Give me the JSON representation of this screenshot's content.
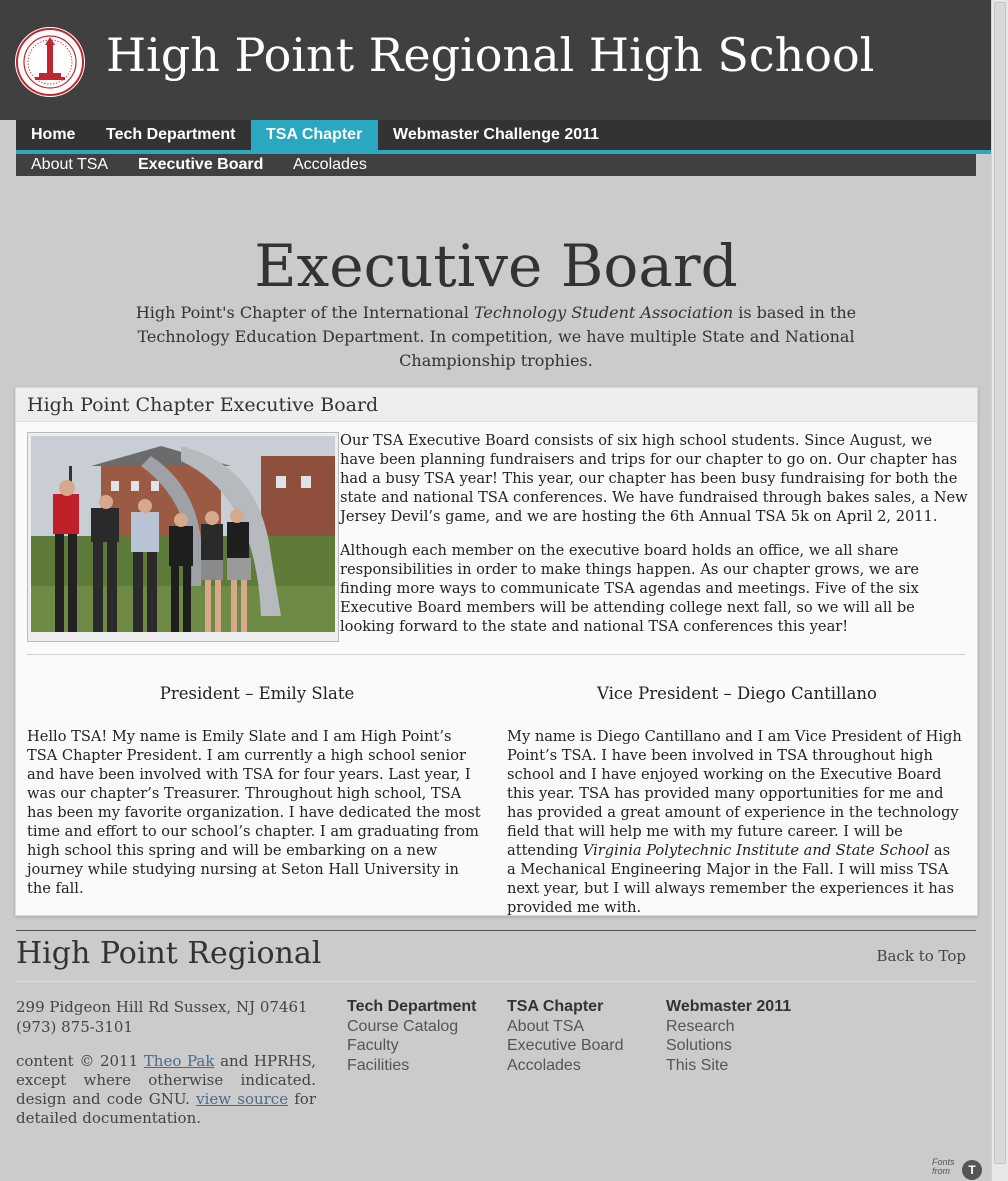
{
  "site": {
    "title": "High Point Regional High School"
  },
  "nav": {
    "main": [
      "Home",
      "Tech Department",
      "TSA Chapter",
      "Webmaster Challenge 2011"
    ],
    "active_main": "TSA Chapter",
    "sub": [
      "About TSA",
      "Executive Board",
      "Accolades"
    ],
    "active_sub": "Executive Board"
  },
  "page": {
    "title": "Executive Board",
    "intro_pre": "High Point's Chapter of the International ",
    "intro_em": "Technology Student Association",
    "intro_post": " is based in the Technology Education Department. In competition, we have multiple State and National Championship trophies."
  },
  "panel": {
    "heading": "High Point Chapter Executive Board",
    "para1": "Our TSA Executive Board consists of six high school students. Since August, we have been planning fundraisers and trips for our chapter to go on. Our chapter has had a busy TSA year! This year, our chapter has been busy fundraising for both the state and national TSA conferences. We have fundraised through bakes sales, a New Jersey Devil’s game, and we are hosting the 6th Annual TSA 5k on April 2, 2011.",
    "para2": "Although each member on the executive board holds an office, we all share responsibilities in order to make things happen. As our chapter grows, we are finding more ways to communicate TSA agendas and meetings. Five of the six Executive Board members will be attending college next fall, so we will all be looking forward to the state and national TSA conferences this year!",
    "president": {
      "heading": "President – Emily Slate",
      "text": "Hello TSA! My name is Emily Slate and I am High Point’s TSA Chapter President. I am currently a high school senior and have been involved with TSA for four years. Last year, I was our chapter’s Treasurer. Throughout high school, TSA has been my favorite organization. I have dedicated the most time and effort to our school’s chapter. I am graduating from high school this spring and will be embarking on a new journey while studying nursing at Seton Hall University in the fall."
    },
    "vice_president": {
      "heading": "Vice President – Diego Cantillano",
      "text_pre": "My name is Diego Cantillano and I am Vice President of High Point’s TSA. I have been involved in TSA throughout high school and I have enjoyed working on the Executive Board this year. TSA has provided many opportunities for me and has provided a great amount of experience in the technology field that will help me with my future career. I will be attending ",
      "text_em": "Virginia Polytechnic Institute and State School",
      "text_post": " as a Mechanical Engineering Major in the Fall. I will miss TSA next year, but I will always remember the experiences it has provided me with."
    }
  },
  "footer": {
    "title": "High Point Regional",
    "back_to_top": "Back to Top",
    "address": "299 Pidgeon Hill Rd Sussex, NJ 07461",
    "phone": "(973) 875-3101",
    "copy_pre": "content © 2011 ",
    "copy_link1": "Theo Pak",
    "copy_mid": " and HPRHS, except where otherwise indicated. design and code GNU. ",
    "copy_link2": "view source",
    "copy_post": " for detailed documentation.",
    "columns": [
      {
        "heading": "Tech Department",
        "links": [
          "Course Catalog",
          "Faculty",
          "Facilities"
        ]
      },
      {
        "heading": "TSA Chapter",
        "links": [
          "About TSA",
          "Executive Board",
          "Accolades"
        ]
      },
      {
        "heading": "Webmaster 2011",
        "links": [
          "Research",
          "Solutions",
          "This Site"
        ]
      }
    ],
    "fonts_badge": {
      "line1": "Fonts",
      "line2": "from",
      "mark": "T"
    }
  },
  "colors": {
    "teal": "#2aa8bf",
    "header": "#404040",
    "background": "#cbcbcb"
  }
}
